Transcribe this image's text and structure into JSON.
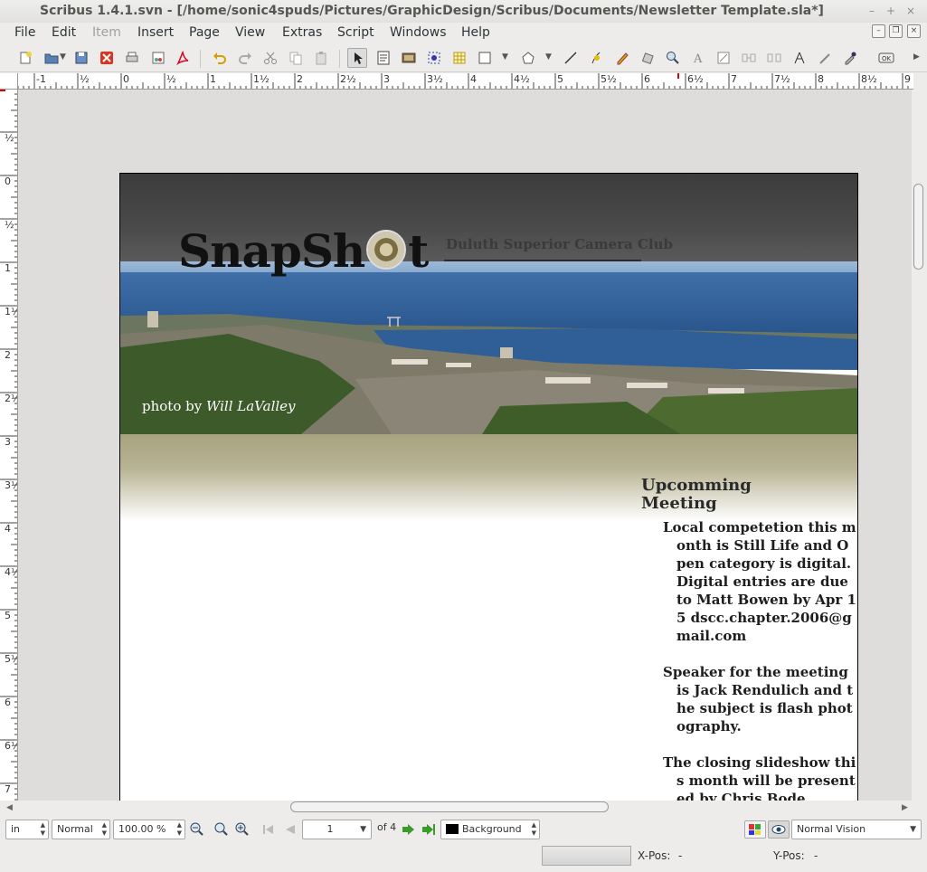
{
  "window": {
    "title": "Scribus 1.4.1.svn - [/home/sonic4spuds/Pictures/GraphicDesign/Scribus/Documents/Newsletter Template.sla*]"
  },
  "menu": {
    "items": [
      "File",
      "Edit",
      "Item",
      "Insert",
      "Page",
      "View",
      "Extras",
      "Script",
      "Windows",
      "Help"
    ]
  },
  "ruler": {
    "h_labels": [
      "-1",
      "½",
      "0",
      "½",
      "1",
      "1½",
      "2",
      "2½",
      "3",
      "3½",
      "4",
      "4½",
      "5",
      "5½",
      "6",
      "6½",
      "7",
      "7½",
      "8",
      "8½",
      "9"
    ],
    "v_labels": [
      "½",
      "0",
      "½",
      "1",
      "1½",
      "2",
      "2½",
      "3",
      "3½",
      "4",
      "4½",
      "5",
      "5½",
      "6",
      "6½",
      "7"
    ]
  },
  "document": {
    "logo_part1": "SnapSh",
    "logo_part2": "t",
    "club_name": "Duluth Superior Camera Club",
    "photo_credit_prefix": "photo by ",
    "photo_credit_name": "Will LaValley",
    "sidebar_title_line1": "Upcomming",
    "sidebar_title_line2": "Meeting",
    "paragraphs": [
      "Local competetion this month is Still Life and Open category is digital. Digital entries are due to Matt Bowen by Apr 15 dscc.chapter.2006@gmail.com",
      "Speaker for the meeting is Jack Rendulich and the subject is flash photography.",
      "The closing slideshow this month will be presented by Chris Bode."
    ]
  },
  "status": {
    "unit": "in",
    "style": "Normal",
    "zoom": "100.00 %",
    "page_current": "1",
    "page_of": "of 4",
    "layer": "Background",
    "vision": "Normal Vision",
    "xpos_label": "X-Pos:",
    "xpos_value": "-",
    "ypos_label": "Y-Pos:",
    "ypos_value": "-"
  },
  "colors": {
    "banner_dark": "#3c3c3c",
    "banner_tan": "#a8a37e",
    "accent_green": "#3a9a2a"
  }
}
